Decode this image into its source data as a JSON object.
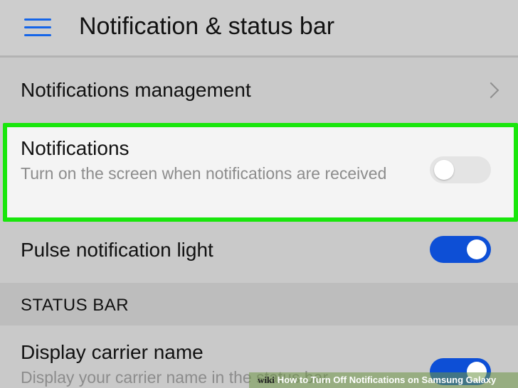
{
  "header": {
    "title": "Notification & status bar",
    "menu_icon": "hamburger-menu-icon",
    "accent_color": "#1565e8"
  },
  "rows": {
    "management": {
      "label": "Notifications management",
      "icon": "chevron-right-icon"
    },
    "notifications": {
      "label": "Notifications",
      "description": "Turn on the screen when notifications are received",
      "toggle_state": "off"
    },
    "pulse": {
      "label": "Pulse notification light",
      "toggle_state": "on"
    },
    "carrier": {
      "label": "Display carrier name",
      "description": "Display your carrier name in the status bar",
      "toggle_state": "on"
    }
  },
  "sections": {
    "status_bar": "STATUS BAR"
  },
  "highlight_color": "#19e60c",
  "toggle_on_color": "#0d4fd6",
  "watermark": {
    "logo": "wiki",
    "text": "How to Turn Off Notifications on Samsung Galaxy"
  }
}
